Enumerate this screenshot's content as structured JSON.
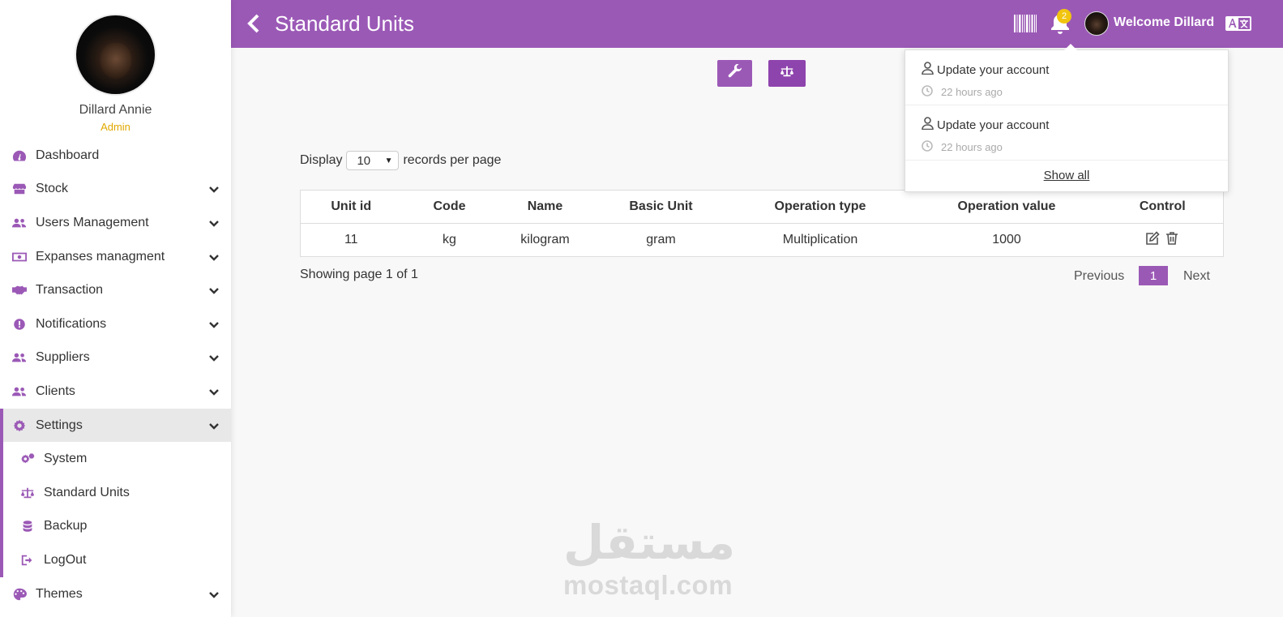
{
  "sidebar": {
    "user_name": "Dillard Annie",
    "user_role": "Admin",
    "items": [
      {
        "label": "Dashboard",
        "icon": "dashboard-icon"
      },
      {
        "label": "Stock",
        "icon": "store-icon"
      },
      {
        "label": "Users Management",
        "icon": "users-icon"
      },
      {
        "label": "Expanses managment",
        "icon": "money-icon"
      },
      {
        "label": "Transaction",
        "icon": "handshake-icon"
      },
      {
        "label": "Notifications",
        "icon": "alert-icon"
      },
      {
        "label": "Suppliers",
        "icon": "users-icon"
      },
      {
        "label": "Clients",
        "icon": "users-icon"
      },
      {
        "label": "Settings",
        "icon": "gear-icon"
      },
      {
        "label": "System",
        "icon": "gears-icon"
      },
      {
        "label": "Standard Units",
        "icon": "scale-icon"
      },
      {
        "label": "Backup",
        "icon": "database-icon"
      },
      {
        "label": "LogOut",
        "icon": "logout-icon"
      },
      {
        "label": "Themes",
        "icon": "palette-icon"
      }
    ]
  },
  "header": {
    "title": "Standard Units",
    "welcome": "Welcome Dillard",
    "notification_count": "2"
  },
  "records": {
    "display_label": "Display",
    "per_page": "10",
    "suffix_label": "records per page"
  },
  "table": {
    "columns": [
      "Unit id",
      "Code",
      "Name",
      "Basic Unit",
      "Operation type",
      "Operation value",
      "Control"
    ],
    "rows": [
      [
        "11",
        "kg",
        "kilogram",
        "gram",
        "Multiplication",
        "1000"
      ]
    ]
  },
  "pagination": {
    "showing": "Showing page 1 of 1",
    "previous": "Previous",
    "current": "1",
    "next": "Next"
  },
  "notifications": {
    "items": [
      {
        "title": "Update your account",
        "time": "22 hours ago"
      },
      {
        "title": "Update your account",
        "time": "22 hours ago"
      }
    ],
    "show_all": "Show all"
  },
  "watermark": {
    "arabic": "مستقل",
    "latin": "mostaql.com"
  },
  "colors": {
    "accent": "#9b59b6",
    "accent_dark": "#8e44ad",
    "badge": "#f1c40f",
    "role": "#e0a800"
  }
}
